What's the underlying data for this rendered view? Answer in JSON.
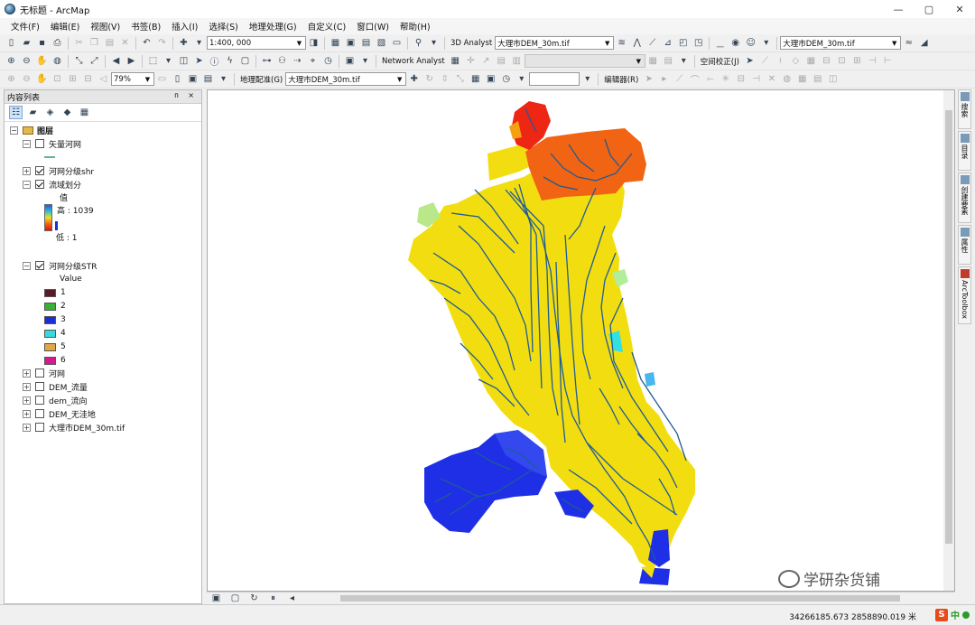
{
  "window": {
    "title": "无标题 - ArcMap",
    "icon": "arcmap-globe-icon"
  },
  "window_controls": {
    "minimize": "—",
    "maximize": "▢",
    "close": "✕"
  },
  "menu": [
    "文件(F)",
    "编辑(E)",
    "视图(V)",
    "书签(B)",
    "插入(I)",
    "选择(S)",
    "地理处理(G)",
    "自定义(C)",
    "窗口(W)",
    "帮助(H)"
  ],
  "toolbar1": {
    "scale": "1:400, 000",
    "analyst_3d": "3D Analyst",
    "layer_combo": "大理市DEM_30m.tif",
    "layer_combo_right": "大理市DEM_30m.tif"
  },
  "toolbar2": {
    "zoom_level_combo": "",
    "network_analyst": "Network Analyst",
    "spatial_adjust": "空间校正(J)"
  },
  "toolbar3": {
    "zoom_percent": "79%",
    "georeference": "地理配准(G)",
    "georef_layer": "大理市DEM_30m.tif",
    "editor": "编辑器(R)"
  },
  "toc": {
    "title": "内容列表",
    "pin": "ᴨ ×",
    "root": "图层",
    "items": {
      "vector_river": "矢量河网",
      "shr": "河网分级shr",
      "basin": "流域划分",
      "basin_value": "值",
      "basin_high": "高 : 1039",
      "basin_low": "低 : 1",
      "str": "河网分级STR",
      "str_value": "Value",
      "river": "河网",
      "dem_flow": "DEM_流量",
      "dem_dir": "dem_流向",
      "dem_fill": "DEM_无洼地",
      "dem_src": "大理市DEM_30m.tif"
    },
    "str_classes": [
      {
        "label": "1",
        "color": "#5a1a28"
      },
      {
        "label": "2",
        "color": "#35b335"
      },
      {
        "label": "3",
        "color": "#1b2fd8"
      },
      {
        "label": "4",
        "color": "#38d8dc"
      },
      {
        "label": "5",
        "color": "#e0a844"
      },
      {
        "label": "6",
        "color": "#d8188f"
      }
    ]
  },
  "right_dock": [
    "搜索",
    "目录",
    "创建要素",
    "属性",
    "ArcToolbox"
  ],
  "status": {
    "coords": "34266185.673  2858890.019 米"
  },
  "ime": {
    "logo": "S",
    "lang": "中"
  },
  "watermark": "学研杂货铺",
  "colors": {
    "basin_yellow": "#f2de10",
    "basin_orange": "#f06414",
    "basin_red": "#ee2614",
    "basin_blue": "#1e2fe6",
    "river_blue": "#1f5b96"
  }
}
